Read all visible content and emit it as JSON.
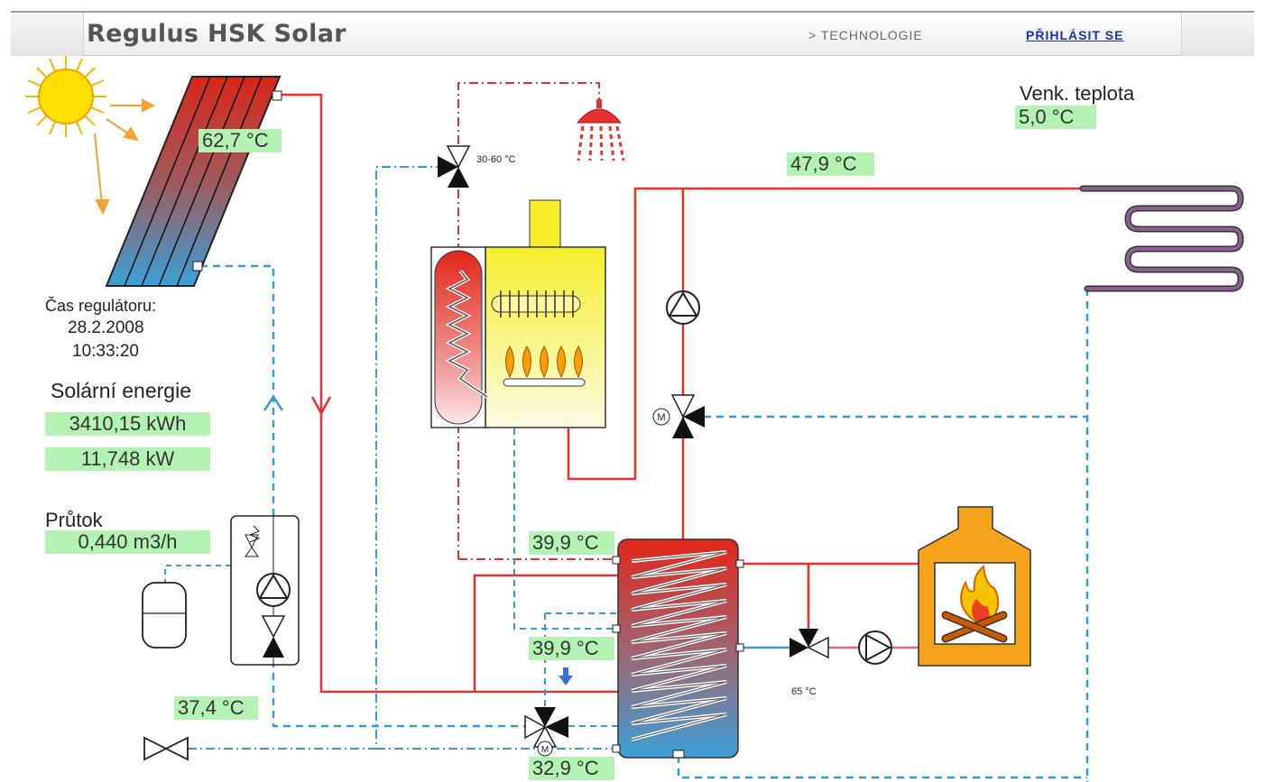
{
  "header": {
    "title": "Regulus HSK Solar",
    "nav_technologie": "> TECHNOLOGIE",
    "login": "PŘIHLÁSIT SE"
  },
  "outdoor": {
    "label": "Venk. teplota",
    "value": "5,0 °C"
  },
  "collector_temp": "62,7 °C",
  "heating_temp": "47,9 °C",
  "controller": {
    "label": "Čas regulátoru:",
    "date": "28.2.2008",
    "time": "10:33:20"
  },
  "solar": {
    "label": "Solární energie",
    "energy": "3410,15 kWh",
    "power": "11,748 kW"
  },
  "flow": {
    "label": "Průtok",
    "value": "0,440 m3/h"
  },
  "return_temp": "37,4 °C",
  "tank": {
    "top_temp": "39,9 °C",
    "mid_temp": "39,9 °C",
    "bottom_temp": "32,9 °C"
  },
  "valve_labels": {
    "dhw_mixer": "30-60 °C",
    "fireplace_valve": "65 °C",
    "motor": "M"
  },
  "colors": {
    "hot_pipe": "#e83030",
    "cold_pipe": "#3a9ad0",
    "value_bg": "#b4f2b4",
    "boiler": "#f5ef2a",
    "fireplace": "#f5a31a"
  }
}
